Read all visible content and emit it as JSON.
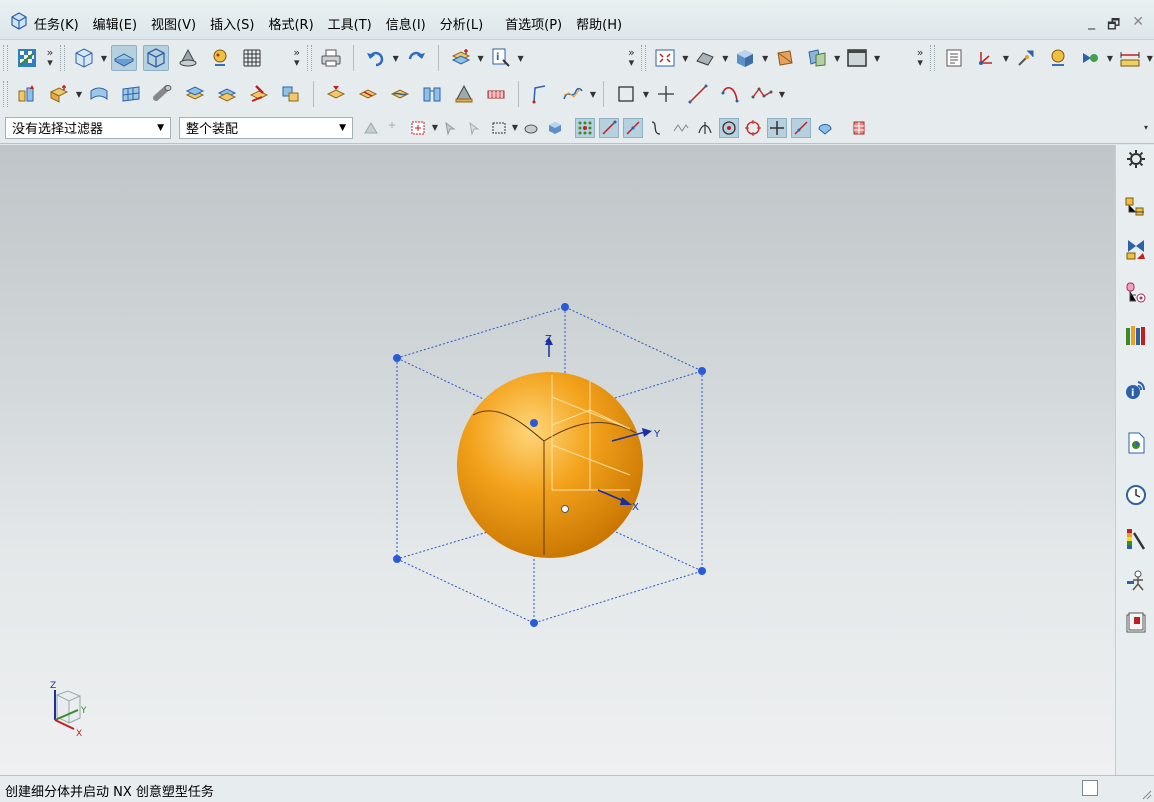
{
  "menubar": {
    "items": [
      "任务(K)",
      "编辑(E)",
      "视图(V)",
      "插入(S)",
      "格式(R)",
      "工具(T)",
      "信息(I)",
      "分析(L)",
      "首选项(P)",
      "帮助(H)"
    ],
    "window_controls": [
      "_",
      "🗗",
      "✕"
    ]
  },
  "toolbar3": {
    "filter_value": "没有选择过滤器",
    "scope_value": "整个装配"
  },
  "viewport": {
    "csys_labels": {
      "z": "Z",
      "y": "Y",
      "x": "X"
    },
    "triad_labels": {
      "z": "Z",
      "y": "Y",
      "x": "X"
    },
    "colors": {
      "sphere": "#f3a21c",
      "box": "#2d55c8",
      "handle": "#2a5bd7"
    }
  },
  "status": {
    "text": "创建细分体并启动 NX 创意塑型任务"
  }
}
